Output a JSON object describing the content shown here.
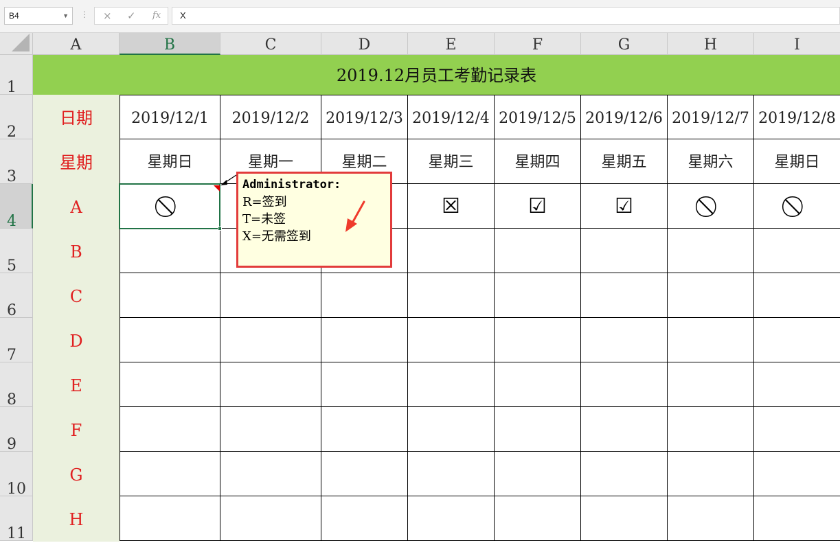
{
  "formula_bar": {
    "name_box": "B4",
    "cancel_icon": "×",
    "enter_icon": "✓",
    "fx_icon": "fx",
    "content": "X"
  },
  "columns": [
    "A",
    "B",
    "C",
    "D",
    "E",
    "F",
    "G",
    "H",
    "I"
  ],
  "selected_column": "B",
  "rows": [
    "1",
    "2",
    "3",
    "4",
    "5",
    "6",
    "7",
    "8",
    "9",
    "10",
    "11"
  ],
  "selected_row": "4",
  "sheet": {
    "title": "2019.12月员工考勤记录表",
    "date_label": "日期",
    "weekday_label": "星期",
    "dates": [
      "2019/12/1",
      "2019/12/2",
      "2019/12/3",
      "2019/12/4",
      "2019/12/5",
      "2019/12/6",
      "2019/12/7",
      "2019/12/8"
    ],
    "weekdays": [
      "星期日",
      "星期一",
      "星期二",
      "星期三",
      "星期四",
      "星期五",
      "星期六",
      "星期日"
    ],
    "employees": [
      "A",
      "B",
      "C",
      "D",
      "E",
      "F",
      "G",
      "H"
    ],
    "row_a_marks": [
      "⃠",
      "",
      "",
      "☒",
      "☑",
      "☑",
      "⃠",
      "⃠"
    ],
    "row_a_mark_names": [
      "no-sign-icon",
      "",
      "",
      "checkbox-x-icon",
      "checkbox-check-icon",
      "checkbox-check-icon",
      "no-sign-icon",
      "no-sign-icon"
    ]
  },
  "comment": {
    "author": "Administrator:",
    "lines": [
      "R=签到",
      "T=未签",
      "X=无需签到"
    ]
  },
  "colors": {
    "title_bg": "#92d050",
    "label_col_bg": "#ebf1de",
    "label_text": "#e02020",
    "selection": "#217346",
    "comment_border": "#e23b3b",
    "comment_bg": "#ffffe1"
  }
}
